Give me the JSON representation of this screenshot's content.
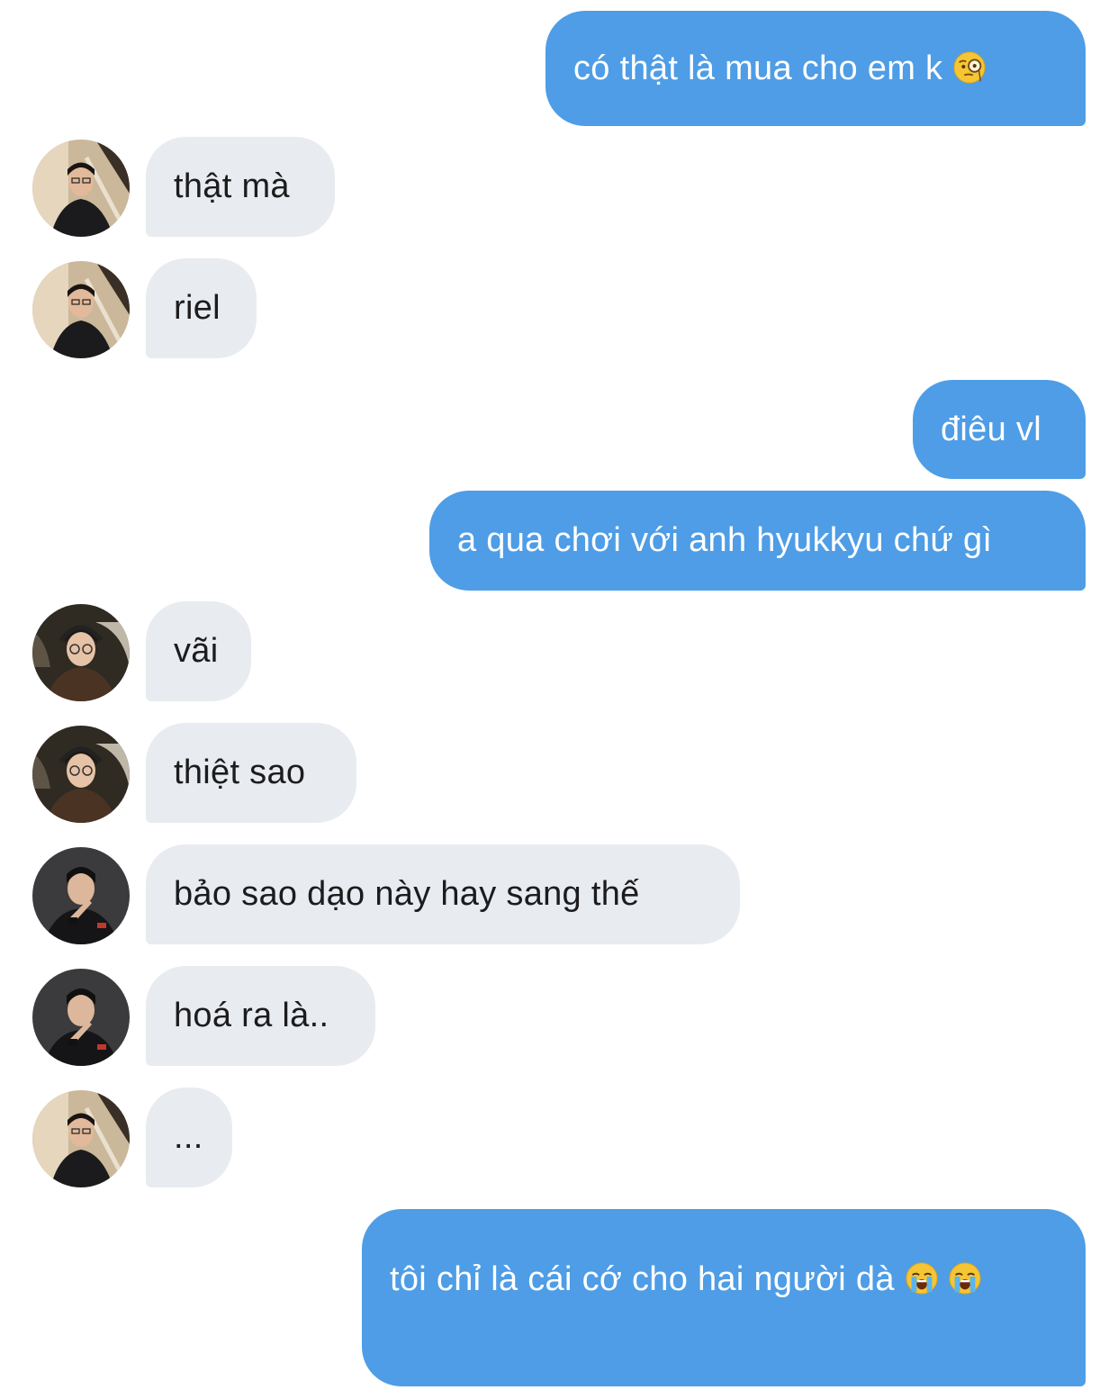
{
  "messages": [
    {
      "text": "có thật là mua cho em k",
      "emoji": "monocle-face-emoji"
    },
    {
      "text": "thật mà"
    },
    {
      "text": "riel"
    },
    {
      "text": "điêu vl"
    },
    {
      "text": "a qua chơi với anh hyukkyu chứ gì"
    },
    {
      "text": "vãi"
    },
    {
      "text": "thiệt sao"
    },
    {
      "text": "bảo sao dạo này hay sang thế"
    },
    {
      "text": "hoá ra là.."
    },
    {
      "text": "..."
    },
    {
      "text": "tôi chỉ là cái cớ cho hai người dà",
      "emoji": "loudly-crying-face-emoji"
    }
  ],
  "colors": {
    "outgoing_bubble": "#4e9de6",
    "incoming_bubble": "#e8ebef",
    "outgoing_text": "#ffffff",
    "incoming_text": "#1c1c1e"
  }
}
